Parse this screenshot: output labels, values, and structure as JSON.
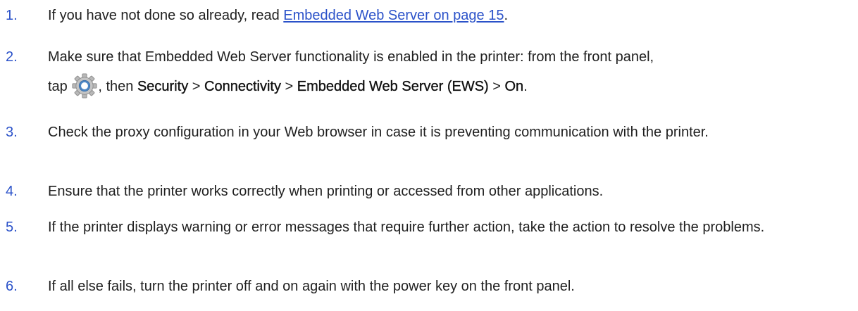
{
  "steps": [
    {
      "number": "1.",
      "before": "If you have not done so already, read ",
      "link": "Embedded Web Server on page 15",
      "after": "."
    },
    {
      "number": "2.",
      "line1": "Make sure that Embedded Web Server functionality is enabled in the printer: from the front panel,",
      "tap": "tap ",
      "icon": "settings-gear-icon",
      "then": ", then ",
      "path_security": "Security",
      "sep1": " > ",
      "path_connectivity": "Connectivity",
      "sep2": " > ",
      "path_ews": "Embedded Web Server (EWS)",
      "sep3": " > ",
      "path_on": "On",
      "end": "."
    },
    {
      "number": "3.",
      "text": "Check the proxy configuration in your Web browser in case it is preventing communication with the printer."
    },
    {
      "number": "4.",
      "text": "Ensure that the printer works correctly when printing or accessed from other applications."
    },
    {
      "number": "5.",
      "text": "If the printer displays warning or error messages that require further action, take the action to resolve the problems."
    },
    {
      "number": "6.",
      "text": "If all else fails, turn the printer off and on again with the power key on the front panel."
    }
  ],
  "colors": {
    "accent": "#2b52c9",
    "text": "#1f1f1f"
  }
}
